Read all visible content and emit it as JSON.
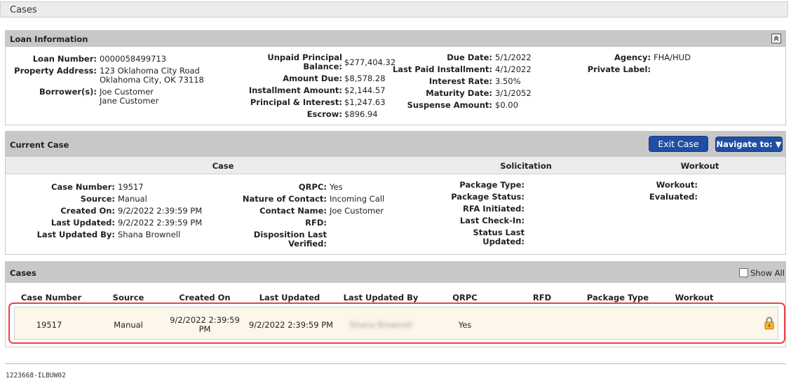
{
  "page": {
    "title": "Cases"
  },
  "loan_info": {
    "header": "Loan Information",
    "col1": [
      {
        "label": "Loan Number:",
        "value": "0000058499713"
      },
      {
        "label": "Property Address:",
        "value_lines": [
          "123 Oklahoma City Road",
          "Oklahoma City, OK 73118"
        ]
      },
      {
        "label": "Borrower(s):",
        "value_lines": [
          "Joe Customer",
          "Jane Customer"
        ]
      }
    ],
    "col2": [
      {
        "label_lines": [
          "Unpaid Principal",
          "Balance:"
        ],
        "value": "$277,404.32"
      },
      {
        "label": "Amount Due:",
        "value": "$8,578.28"
      },
      {
        "label": "Installment Amount:",
        "value": "$2,144.57"
      },
      {
        "label": "Principal & Interest:",
        "value": "$1,247.63"
      },
      {
        "label": "Escrow:",
        "value": "$896.94"
      }
    ],
    "col3": [
      {
        "label": "Due Date:",
        "value": "5/1/2022"
      },
      {
        "label": "Last Paid Installment:",
        "value": "4/1/2022"
      },
      {
        "label": "Interest Rate:",
        "value": "3.50%"
      },
      {
        "label": "Maturity Date:",
        "value": "3/1/2052"
      },
      {
        "label": "Suspense Amount:",
        "value": "$0.00"
      }
    ],
    "col4": [
      {
        "label": "Agency:",
        "value": "FHA/HUD"
      },
      {
        "label": "Private Label:",
        "value": ""
      }
    ]
  },
  "current_case": {
    "header": "Current Case",
    "exit_label": "Exit Case",
    "navigate_label": "Navigate to: ▼",
    "sections": {
      "case": "Case",
      "solicitation": "Solicitation",
      "workout": "Workout"
    },
    "col1": [
      {
        "label": "Case Number:",
        "value": "19517"
      },
      {
        "label": "Source:",
        "value": "Manual"
      },
      {
        "label": "Created On:",
        "value": "9/2/2022 2:39:59 PM"
      },
      {
        "label": "Last Updated:",
        "value": "9/2/2022 2:39:59 PM"
      },
      {
        "label": "Last Updated By:",
        "value": "Shana Brownell"
      }
    ],
    "col2": [
      {
        "label": "QRPC:",
        "value": "Yes"
      },
      {
        "label": "Nature of Contact:",
        "value": "Incoming Call"
      },
      {
        "label": "Contact Name:",
        "value": "Joe Customer"
      },
      {
        "label": "RFD:",
        "value": ""
      },
      {
        "label_lines": [
          "Disposition Last",
          "Verified:"
        ],
        "value": ""
      }
    ],
    "col3": [
      {
        "label": "Package Type:"
      },
      {
        "label": "Package Status:"
      },
      {
        "label": "RFA Initiated:"
      },
      {
        "label": "Last Check-In:"
      },
      {
        "label_lines": [
          "Status Last",
          "Updated:"
        ]
      }
    ],
    "col4": [
      {
        "label": "Workout:"
      },
      {
        "label": "Evaluated:"
      }
    ]
  },
  "cases": {
    "header": "Cases",
    "show_all_label": "Show All",
    "columns": [
      "Case Number",
      "Source",
      "Created On",
      "Last Updated",
      "Last Updated By",
      "QRPC",
      "RFD",
      "Package Type",
      "Workout"
    ],
    "rows": [
      {
        "case_number": "19517",
        "source": "Manual",
        "created_on_lines": [
          "9/2/2022 2:39:59",
          "PM"
        ],
        "last_updated": "9/2/2022 2:39:59 PM",
        "last_updated_by": "Shana Brownell",
        "qrpc": "Yes",
        "rfd": "",
        "package_type": "",
        "workout": ""
      }
    ]
  },
  "footer": {
    "text": "1223668-ILBUW02"
  },
  "colors": {
    "accent_blue": "#1f4ea3",
    "highlight_red": "#e8434a",
    "row_bg": "#fdf6ea",
    "panel_header": "#c8c8c8"
  }
}
